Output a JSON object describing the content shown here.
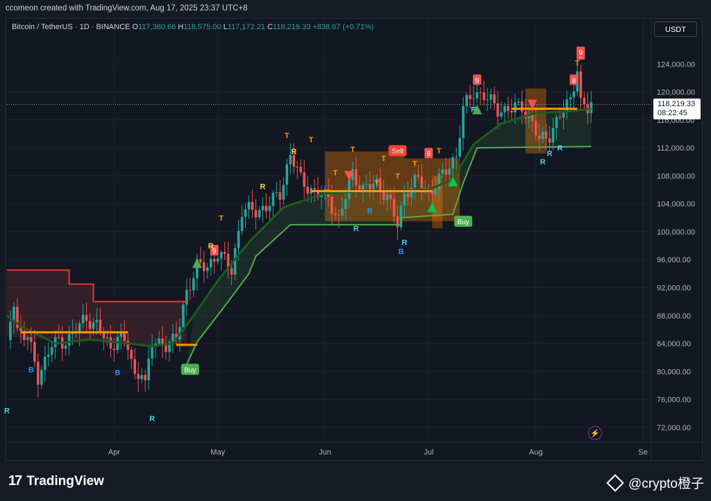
{
  "credit": "ccomeon created with TradingView.com, Aug 17, 2025 23:37 UTC+8",
  "header": {
    "symbol": "Bitcoin / TetherUS · 1D · BINANCE",
    "o_label": "O",
    "o_val": "117,380.66",
    "h_label": "H",
    "h_val": "118,575.00",
    "l_label": "L",
    "l_val": "117,172.21",
    "c_label": "C",
    "c_val": "118,219.33",
    "change": "+838.67 (+0.71%)"
  },
  "currency": "USDT",
  "price_label": {
    "price": "118,219.33",
    "countdown": "08:22:45"
  },
  "footer": {
    "brand": "TradingView",
    "brand_mark": "17",
    "watermark": "@crypto橙子"
  },
  "colors": {
    "up": "#26a69a",
    "down": "#ef5350",
    "support": "#4caf50",
    "resistance": "#e53935",
    "ema": "#1b5e20",
    "tsignal": "#ff9800",
    "rsignal": "#4dd0e1",
    "bsignal": "#2196f3",
    "box": "#f57c00"
  },
  "chart_data": {
    "type": "line",
    "title": "",
    "xlabel": "",
    "ylabel": "",
    "x_ticks": [
      "Apr",
      "May",
      "Jun",
      "Jul",
      "Aug",
      "Se"
    ],
    "y_ticks": [
      "72,000.00",
      "76,000.00",
      "80,000.00",
      "84,000.00",
      "88,000.00",
      "92,000.00",
      "96,000.00",
      "100,000.00",
      "104,000.00",
      "108,000.00",
      "112,000.00",
      "116,000.00",
      "120,000.00",
      "124,000.00"
    ],
    "ylim": [
      70000,
      128000
    ],
    "xlim": [
      "2025-03-01",
      "2025-09-03"
    ],
    "grid": true,
    "series": [
      {
        "values": [
          [
            "2025-03-01",
            84500
          ],
          [
            "2025-03-03",
            90000
          ],
          [
            "2025-03-04",
            86000
          ],
          [
            "2025-03-07",
            85000
          ],
          [
            "2025-03-10",
            79000
          ],
          [
            "2025-03-11",
            80500
          ],
          [
            "2025-03-14",
            84000
          ],
          [
            "2025-03-17",
            84000
          ],
          [
            "2025-03-20",
            85500
          ],
          [
            "2025-03-24",
            87500
          ],
          [
            "2025-03-27",
            86800
          ],
          [
            "2025-03-31",
            83000
          ],
          [
            "2025-04-02",
            85500
          ],
          [
            "2025-04-05",
            83500
          ],
          [
            "2025-04-07",
            79000
          ],
          [
            "2025-04-09",
            80500
          ],
          [
            "2025-04-10",
            78200
          ],
          [
            "2025-04-12",
            84000
          ],
          [
            "2025-04-16",
            84000
          ],
          [
            "2025-04-19",
            84500
          ],
          [
            "2025-04-22",
            91500
          ],
          [
            "2025-04-25",
            95000
          ],
          [
            "2025-04-28",
            95000
          ],
          [
            "2025-05-01",
            97000
          ],
          [
            "2025-05-05",
            94500
          ],
          [
            "2025-05-08",
            103000
          ],
          [
            "2025-05-12",
            103000
          ],
          [
            "2025-05-15",
            103500
          ],
          [
            "2025-05-19",
            105500
          ],
          [
            "2025-05-22",
            111000
          ],
          [
            "2025-05-25",
            107500
          ],
          [
            "2025-05-29",
            105500
          ],
          [
            "2025-06-02",
            105000
          ],
          [
            "2025-06-05",
            101500
          ],
          [
            "2025-06-09",
            108500
          ],
          [
            "2025-06-12",
            106000
          ],
          [
            "2025-06-16",
            107000
          ],
          [
            "2025-06-19",
            105000
          ],
          [
            "2025-06-22",
            101000
          ],
          [
            "2025-06-24",
            105500
          ],
          [
            "2025-06-28",
            107500
          ],
          [
            "2025-07-01",
            105500
          ],
          [
            "2025-07-05",
            108000
          ],
          [
            "2025-07-09",
            111000
          ],
          [
            "2025-07-11",
            117500
          ],
          [
            "2025-07-14",
            120000
          ],
          [
            "2025-07-17",
            119500
          ],
          [
            "2025-07-21",
            117500
          ],
          [
            "2025-07-25",
            117500
          ],
          [
            "2025-07-28",
            118000
          ],
          [
            "2025-07-31",
            115500
          ],
          [
            "2025-08-02",
            113000
          ],
          [
            "2025-08-05",
            114000
          ],
          [
            "2025-08-08",
            116500
          ],
          [
            "2025-08-11",
            119000
          ],
          [
            "2025-08-13",
            123500
          ],
          [
            "2025-08-14",
            118300
          ],
          [
            "2025-08-16",
            117400
          ],
          [
            "2025-08-17",
            118219
          ]
        ]
      },
      {
        "values": [
          [
            "2025-03-01",
            88000
          ],
          [
            "2025-03-05",
            86500
          ],
          [
            "2025-03-15",
            84000
          ],
          [
            "2025-03-25",
            84600
          ],
          [
            "2025-04-05",
            84000
          ],
          [
            "2025-04-12",
            83600
          ],
          [
            "2025-04-18",
            84000
          ],
          [
            "2025-04-24",
            88000
          ],
          [
            "2025-05-01",
            93000
          ],
          [
            "2025-05-10",
            98500
          ],
          [
            "2025-05-20",
            103500
          ],
          [
            "2025-06-01",
            105500
          ],
          [
            "2025-06-15",
            105800
          ],
          [
            "2025-07-01",
            106000
          ],
          [
            "2025-07-08",
            107500
          ],
          [
            "2025-07-14",
            112500
          ],
          [
            "2025-07-22",
            115500
          ],
          [
            "2025-08-01",
            117000
          ],
          [
            "2025-08-10",
            117200
          ],
          [
            "2025-08-17",
            117600
          ]
        ]
      },
      {
        "values": [
          [
            "2025-04-22",
            81000
          ],
          [
            "2025-04-25",
            84200
          ],
          [
            "2025-05-04",
            90000
          ],
          [
            "2025-05-10",
            94000
          ],
          [
            "2025-05-12",
            96500
          ],
          [
            "2025-05-22",
            101000
          ],
          [
            "2025-06-23",
            101000
          ],
          [
            "2025-06-23",
            102000
          ],
          [
            "2025-07-08",
            102500
          ],
          [
            "2025-07-11",
            107000
          ],
          [
            "2025-07-15",
            112000
          ],
          [
            "2025-08-17",
            112200
          ]
        ]
      },
      {
        "values": [
          [
            "2025-03-01",
            94500
          ],
          [
            "2025-03-19",
            94500
          ],
          [
            "2025-03-19",
            92500
          ],
          [
            "2025-03-26",
            92500
          ],
          [
            "2025-03-26",
            90000
          ],
          [
            "2025-04-22",
            90000
          ]
        ]
      }
    ],
    "annotations": [
      "Buy",
      "Buy",
      "Sell",
      "B",
      "B",
      "B",
      "B",
      "R",
      "R",
      "R",
      "R",
      "R",
      "R",
      "R",
      "R",
      "R",
      "T",
      "T",
      "T",
      "T",
      "T",
      "T",
      "T",
      "T",
      "T",
      "T",
      "T",
      "9",
      "9",
      "8",
      "8",
      "8",
      "9",
      "R",
      "R",
      "R"
    ]
  }
}
